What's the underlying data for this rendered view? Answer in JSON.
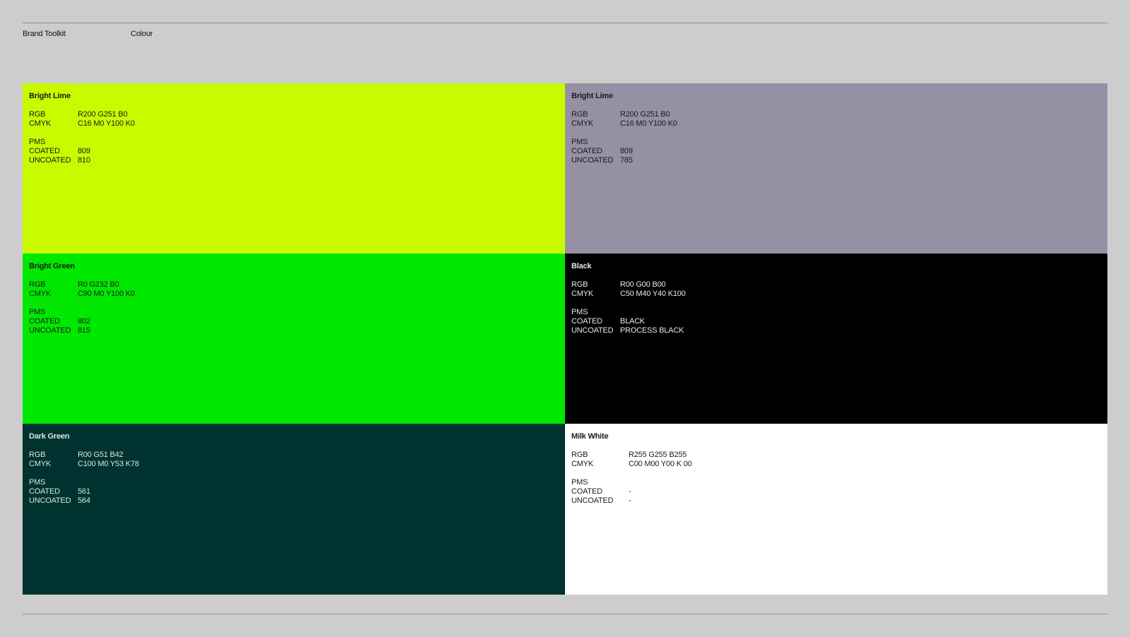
{
  "header": {
    "left": "Brand Toolkit",
    "right": "Colour"
  },
  "swatches": [
    {
      "name": "Bright Lime",
      "color": "#c8fb00",
      "rgb_label": "RGB",
      "rgb": "R200  G251  B0",
      "cmyk_label": "CMYK",
      "cmyk": "C16 M0 Y100 K0",
      "pms_label": "PMS",
      "coated_label": "COATED",
      "coated": "809",
      "uncoated_label": "UNCOATED",
      "uncoated": "810"
    },
    {
      "name": "Bright Lime",
      "color": "#9590a3",
      "rgb_label": "RGB",
      "rgb": "R200  G251  B0",
      "cmyk_label": "CMYK",
      "cmyk": "C16 M0 Y100 K0",
      "pms_label": "PMS",
      "coated_label": "COATED",
      "coated": "809",
      "uncoated_label": "UNCOATED",
      "uncoated": "785"
    },
    {
      "name": "Bright Green",
      "color": "#00e800",
      "rgb_label": "RGB",
      "rgb": "R0 G232 B0",
      "cmyk_label": "CMYK",
      "cmyk": "C90 M0 Y100 K0",
      "pms_label": "PMS",
      "coated_label": "COATED",
      "coated": "802",
      "uncoated_label": "UNCOATED",
      "uncoated": "815"
    },
    {
      "name": "Black",
      "color": "#000000",
      "rgb_label": "RGB",
      "rgb": "R00 G00 B00",
      "cmyk_label": "CMYK",
      "cmyk": "C50 M40 Y40 K100",
      "pms_label": "PMS",
      "coated_label": "COATED",
      "coated": "BLACK",
      "uncoated_label": "UNCOATED",
      "uncoated": "PROCESS BLACK"
    },
    {
      "name": "Dark Green",
      "color": "#003330",
      "rgb_label": "RGB",
      "rgb": "R00 G51 B42",
      "cmyk_label": "CMYK",
      "cmyk": "C100 M0 Y53 K78",
      "pms_label": "PMS",
      "coated_label": "COATED",
      "coated": "561",
      "uncoated_label": "UNCOATED",
      "uncoated": "564"
    },
    {
      "name": "Milk White",
      "color": "#ffffff",
      "rgb_label": "RGB",
      "rgb": "R255 G255 B255",
      "cmyk_label": "CMYK",
      "cmyk": "C00  M00 Y00 K 00",
      "pms_label": "PMS",
      "coated_label": "COATED",
      "coated": "-",
      "uncoated_label": "UNCOATED",
      "uncoated": "-"
    }
  ]
}
